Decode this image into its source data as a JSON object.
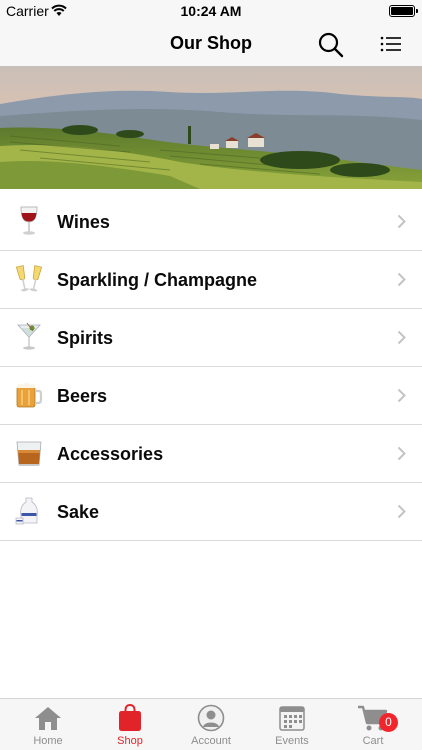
{
  "status_bar": {
    "carrier": "Carrier",
    "time": "10:24 AM"
  },
  "nav": {
    "title": "Our Shop"
  },
  "categories": [
    {
      "label": "Wines",
      "icon": "wine-glass-icon"
    },
    {
      "label": "Sparkling / Champagne",
      "icon": "champagne-glasses-icon"
    },
    {
      "label": "Spirits",
      "icon": "cocktail-glass-icon"
    },
    {
      "label": "Beers",
      "icon": "beer-mug-icon"
    },
    {
      "label": "Accessories",
      "icon": "whisky-tumbler-icon"
    },
    {
      "label": "Sake",
      "icon": "sake-bottle-icon"
    }
  ],
  "tabs": [
    {
      "label": "Home",
      "icon": "home-icon"
    },
    {
      "label": "Shop",
      "icon": "shopping-bag-icon",
      "active": true
    },
    {
      "label": "Account",
      "icon": "account-icon"
    },
    {
      "label": "Events",
      "icon": "calendar-icon"
    },
    {
      "label": "Cart",
      "icon": "cart-icon",
      "badge": "0"
    }
  ],
  "colors": {
    "accent": "#e0242a",
    "badge": "#f0262c",
    "tab_inactive": "#8e8e8e"
  }
}
